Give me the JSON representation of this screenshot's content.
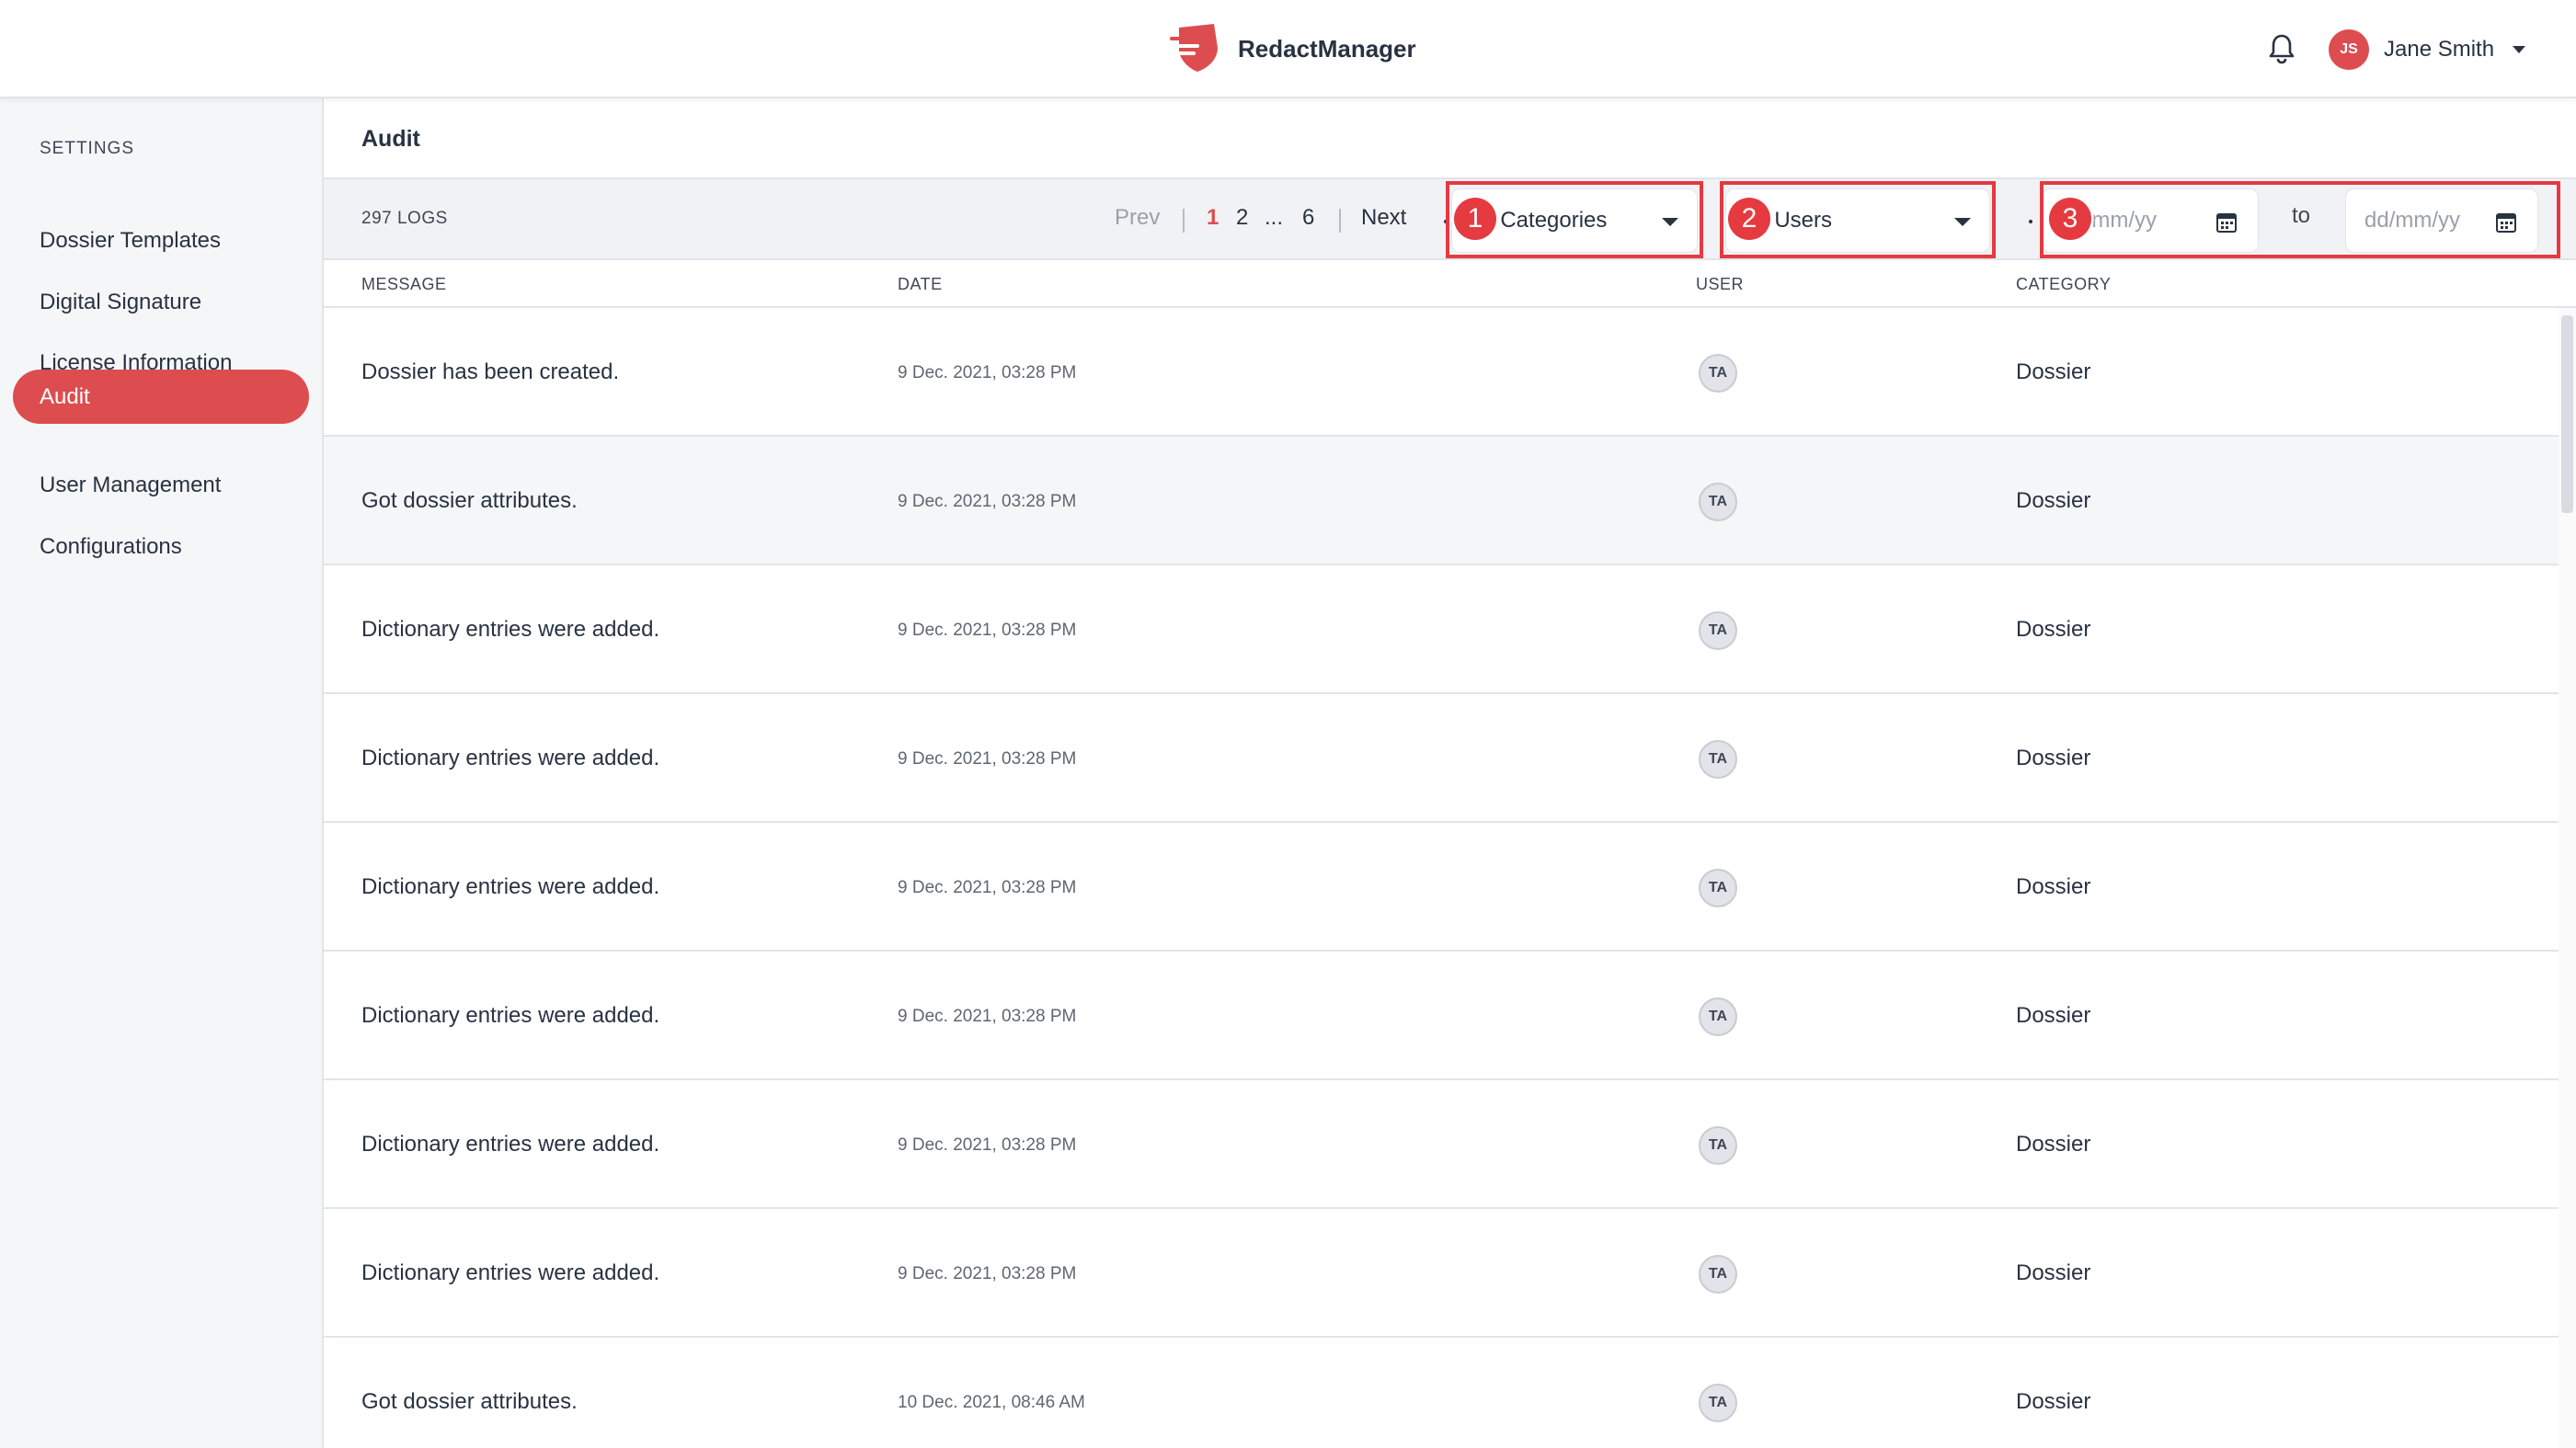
{
  "app": {
    "brand_name": "RedactManager",
    "brand_color": "#dd4d50"
  },
  "header": {
    "notification_icon": "bell-icon",
    "user": {
      "initials": "JS",
      "name": "Jane Smith"
    }
  },
  "sidebar": {
    "title": "SETTINGS",
    "items": [
      {
        "label": "Dossier Templates",
        "active": false
      },
      {
        "label": "Digital Signature",
        "active": false
      },
      {
        "label": "License Information",
        "active": false
      },
      {
        "label": "Audit",
        "active": true
      },
      {
        "label": "User Management",
        "active": false
      },
      {
        "label": "Configurations",
        "active": false
      }
    ]
  },
  "main": {
    "title": "Audit",
    "toolbar": {
      "logs_count": "297 LOGS",
      "pagination": {
        "prev": "Prev",
        "pages": [
          "1",
          "2",
          "...",
          "6"
        ],
        "current": "1",
        "next": "Next"
      },
      "category_filter": {
        "value": "All Categories"
      },
      "user_filter": {
        "value": "All Users"
      },
      "date_from": {
        "placeholder": "dd/mm/yy"
      },
      "date_to_label": "to",
      "date_to": {
        "placeholder": "dd/mm/yy"
      },
      "callouts": [
        "1",
        "2",
        "3"
      ]
    },
    "table": {
      "columns": [
        "MESSAGE",
        "DATE",
        "USER",
        "CATEGORY"
      ],
      "rows": [
        {
          "message": "Dossier has been created.",
          "date": "9 Dec. 2021, 03:28 PM",
          "user": "TA",
          "category": "Dossier"
        },
        {
          "message": "Got dossier attributes.",
          "date": "9 Dec. 2021, 03:28 PM",
          "user": "TA",
          "category": "Dossier"
        },
        {
          "message": "Dictionary entries were added.",
          "date": "9 Dec. 2021, 03:28 PM",
          "user": "TA",
          "category": "Dossier"
        },
        {
          "message": "Dictionary entries were added.",
          "date": "9 Dec. 2021, 03:28 PM",
          "user": "TA",
          "category": "Dossier"
        },
        {
          "message": "Dictionary entries were added.",
          "date": "9 Dec. 2021, 03:28 PM",
          "user": "TA",
          "category": "Dossier"
        },
        {
          "message": "Dictionary entries were added.",
          "date": "9 Dec. 2021, 03:28 PM",
          "user": "TA",
          "category": "Dossier"
        },
        {
          "message": "Dictionary entries were added.",
          "date": "9 Dec. 2021, 03:28 PM",
          "user": "TA",
          "category": "Dossier"
        },
        {
          "message": "Dictionary entries were added.",
          "date": "9 Dec. 2021, 03:28 PM",
          "user": "TA",
          "category": "Dossier"
        },
        {
          "message": "Got dossier attributes.",
          "date": "10 Dec. 2021, 08:46 AM",
          "user": "TA",
          "category": "Dossier"
        }
      ]
    }
  }
}
